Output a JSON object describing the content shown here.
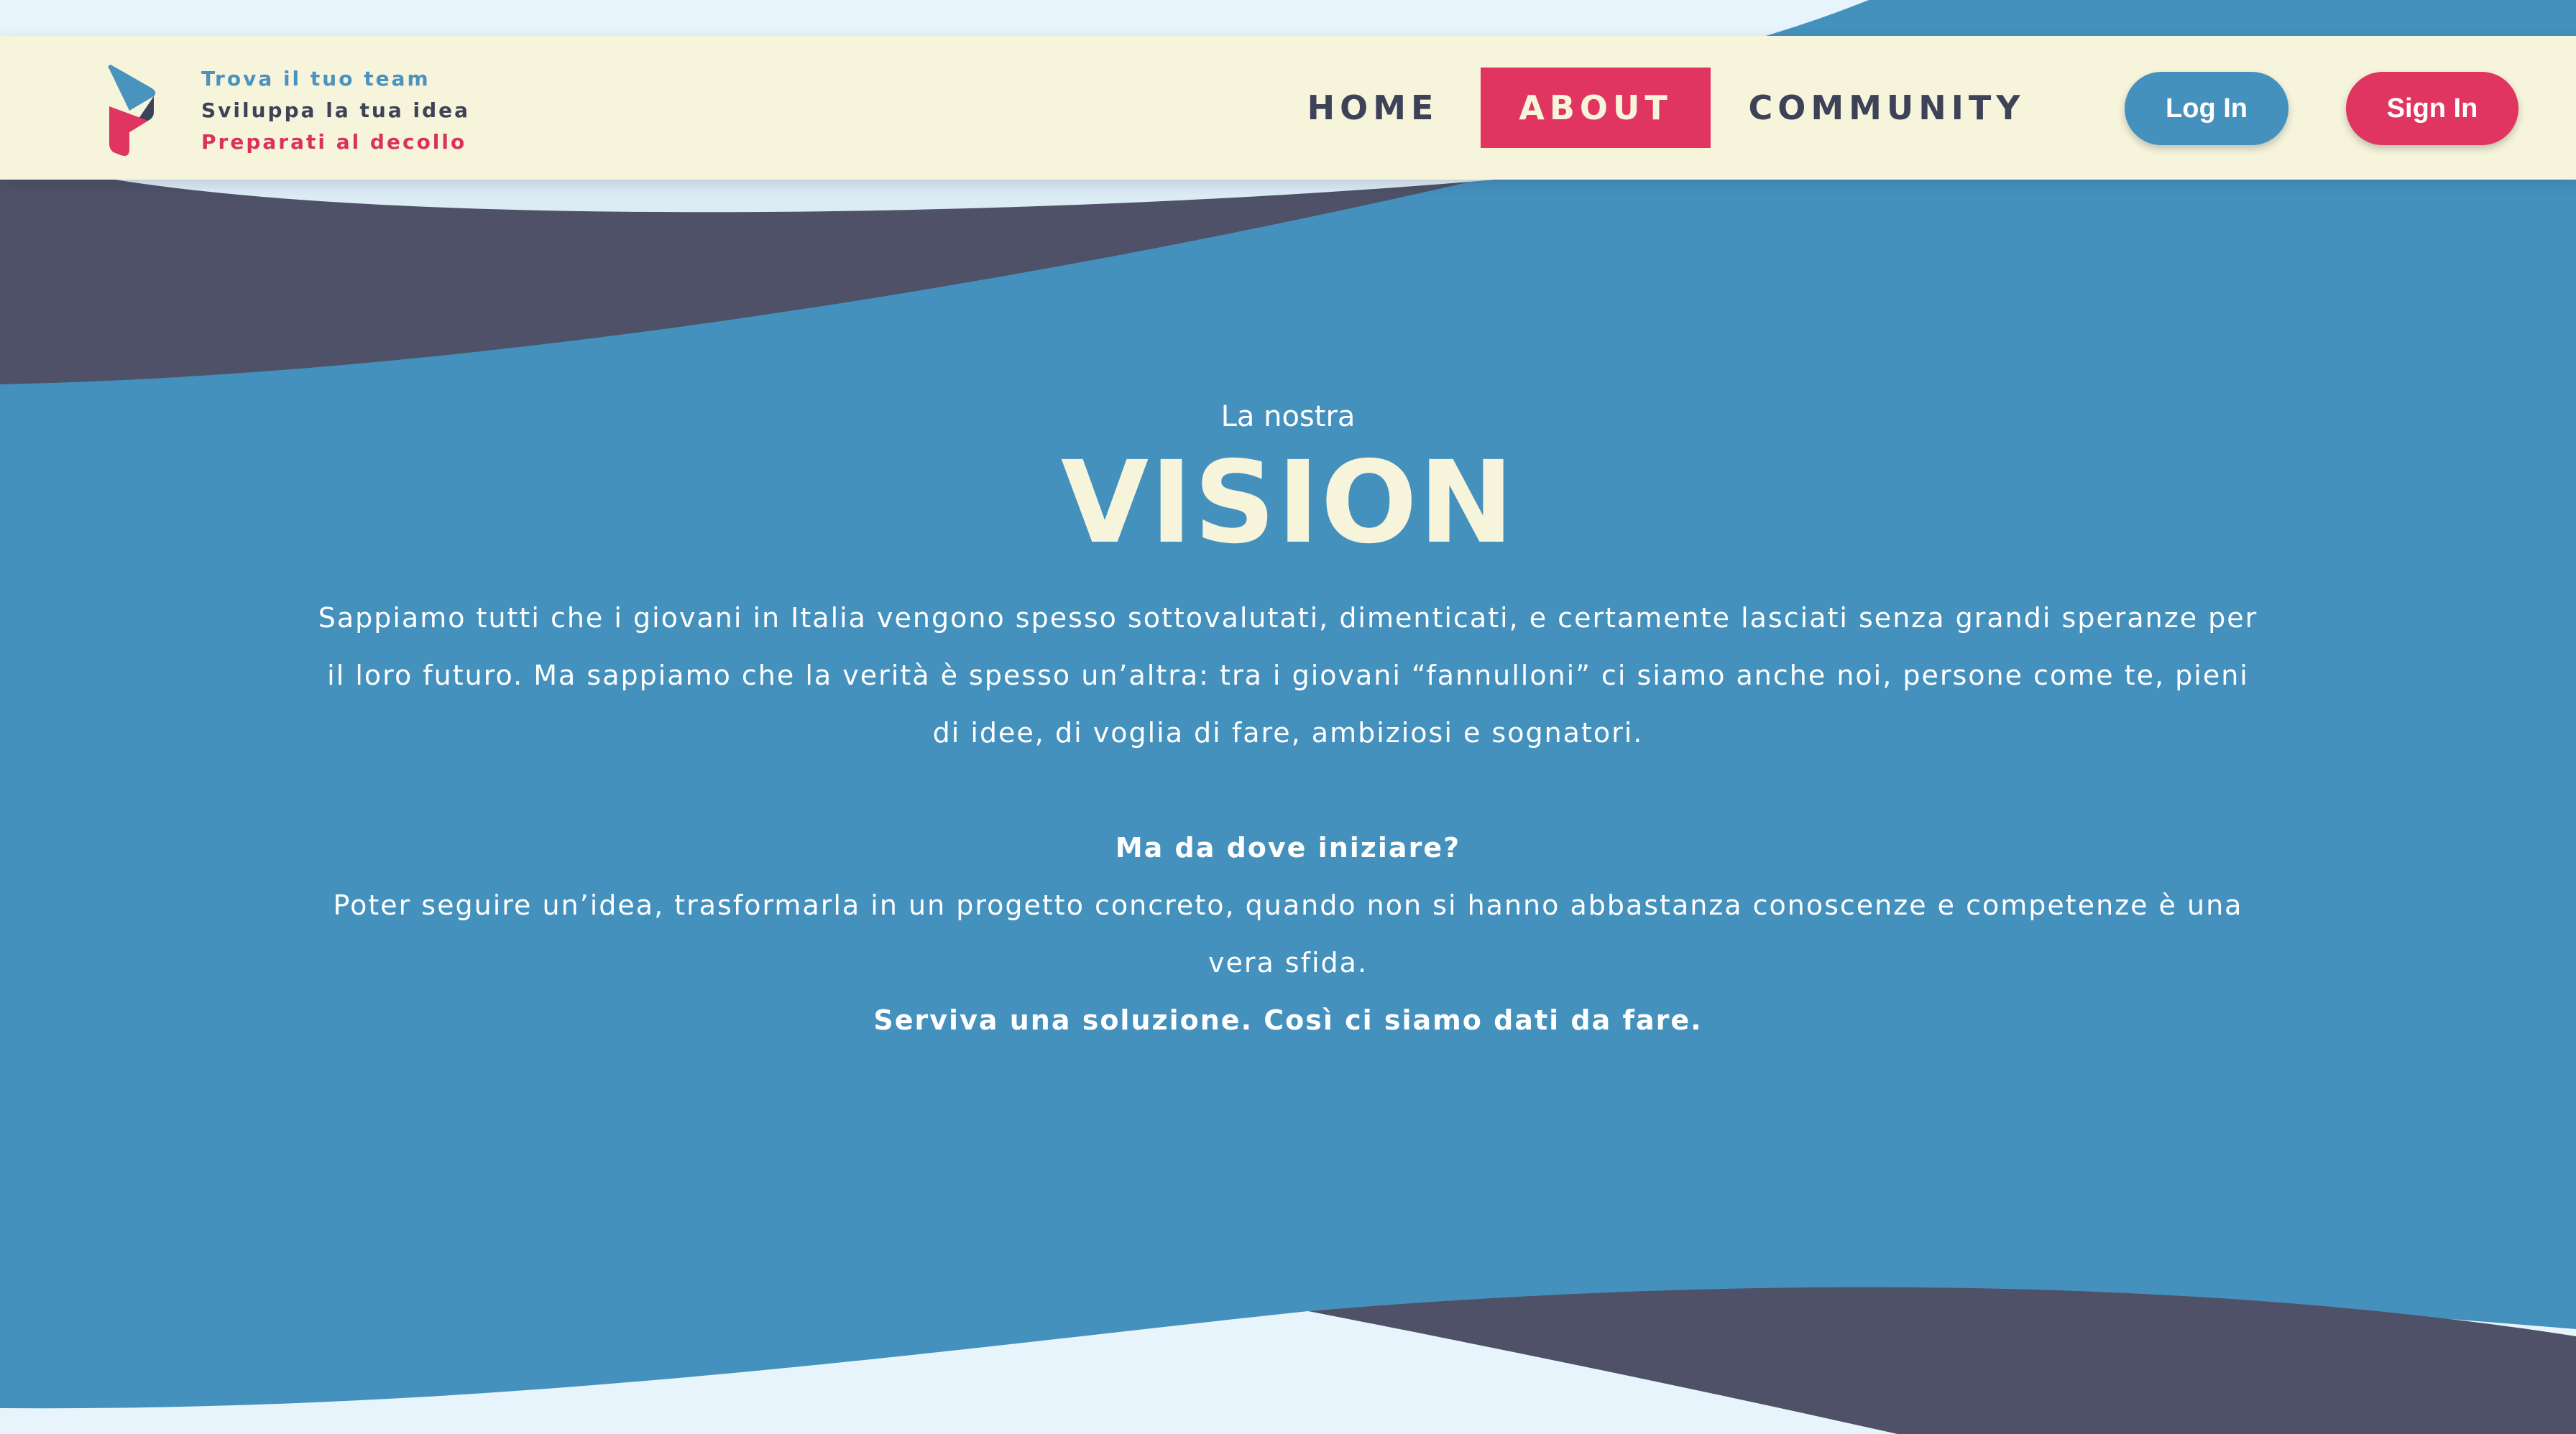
{
  "header": {
    "taglines": [
      "Trova il tuo team",
      "Sviluppa la tua idea",
      "Preparati al decollo"
    ],
    "nav": [
      {
        "label": "HOME",
        "active": false
      },
      {
        "label": "ABOUT",
        "active": true
      },
      {
        "label": "COMMUNITY",
        "active": false
      }
    ],
    "login_label": "Log In",
    "signin_label": "Sign In"
  },
  "vision": {
    "pretitle": "La nostra",
    "title": "VISION",
    "paragraph1": "Sappiamo tutti che i giovani in Italia vengono spesso sottovalutati, dimenticati, e certamente lasciati senza grandi speranze per il loro futuro. Ma sappiamo che la verità è spesso un’altra: tra i giovani “fannulloni” ci siamo anche noi, persone come te, pieni di idee, di voglia di fare, ambiziosi e sognatori.",
    "question": "Ma da dove iniziare?",
    "paragraph2": "Poter seguire un’idea, trasformarla in un progetto concreto, quando non si hanno abbastanza conoscenze e competenze è una vera sfida.",
    "closing": "Serviva una soluzione. Così ci siamo dati da fare."
  },
  "colors": {
    "primary_blue": "#4491be",
    "dark_slate": "#4e5168",
    "cream": "#f6f4da",
    "accent_pink": "#e13561",
    "light_sky": "#e8f4fb"
  }
}
